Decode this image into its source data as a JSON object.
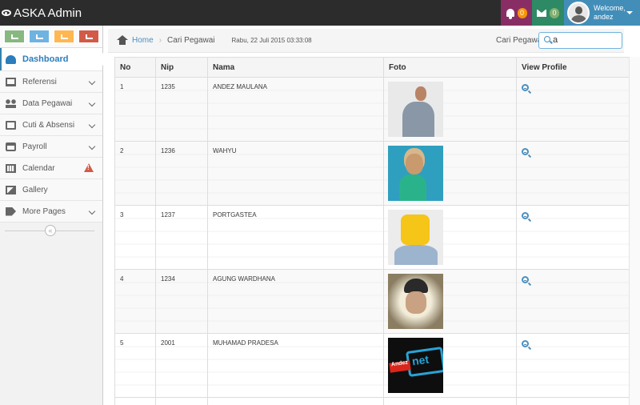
{
  "navbar": {
    "brand": "ASKA Admin",
    "notifications_count": "0",
    "messages_count": "0",
    "welcome": "Welcome,",
    "username": "andez"
  },
  "shortcuts": [
    "stats-icon",
    "pencil-icon",
    "users-icon",
    "cogs-icon"
  ],
  "sidebar": {
    "items": [
      {
        "label": "Dashboard",
        "icon": "dashboard-icon"
      },
      {
        "label": "Referensi",
        "icon": "desktop-icon"
      },
      {
        "label": "Data Pegawai",
        "icon": "users-icon"
      },
      {
        "label": "Cuti & Absensi",
        "icon": "edit-icon"
      },
      {
        "label": "Payroll",
        "icon": "credit-card-icon"
      },
      {
        "label": "Calendar",
        "icon": "calendar-icon"
      },
      {
        "label": "Gallery",
        "icon": "picture-icon"
      },
      {
        "label": "More Pages",
        "icon": "tag-icon"
      }
    ],
    "collapse_glyph": "«"
  },
  "breadcrumb": {
    "home": "Home",
    "current": "Cari Pegawai",
    "date": "Rabu, 22 Juli 2015 03:33:08"
  },
  "search": {
    "label": "Cari Pegawai",
    "value": "a"
  },
  "table": {
    "headers": [
      "No",
      "Nip",
      "Nama",
      "Foto",
      "View Profile"
    ],
    "rows": [
      {
        "no": "1",
        "nip": "1235",
        "nama": "ANDEZ MAULANA"
      },
      {
        "no": "2",
        "nip": "1236",
        "nama": "WAHYU"
      },
      {
        "no": "3",
        "nip": "1237",
        "nama": "PORTGASTEA"
      },
      {
        "no": "4",
        "nip": "1234",
        "nama": "AGUNG WARDHANA"
      },
      {
        "no": "5",
        "nip": "2001",
        "nama": "MUHAMAD PRADESA"
      }
    ],
    "photo5_text_a": "Andez",
    "photo5_text_b": "net"
  },
  "colors": {
    "navbar": "#2c2c2c",
    "notif": "#892e65",
    "messages": "#2e8965",
    "user": "#438eb9",
    "accent": "#2b7dbc"
  }
}
